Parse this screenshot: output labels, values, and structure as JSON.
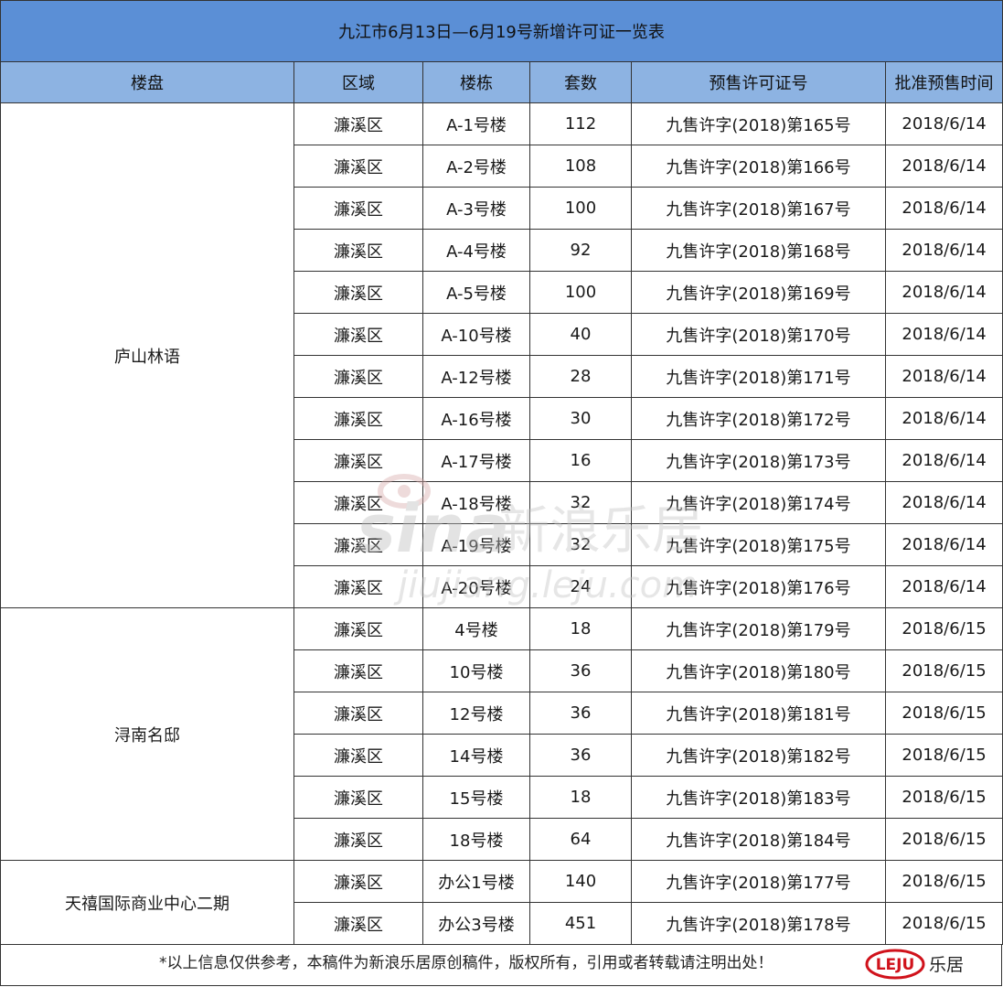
{
  "title": "九江市6月13日—6月19号新增许可证一览表",
  "headers": [
    "楼盘",
    "区域",
    "楼栋",
    "套数",
    "预售许可证号",
    "批准预售时间"
  ],
  "projects": [
    {
      "name": "庐山林语",
      "rows": [
        {
          "district": "濂溪区",
          "building": "A-1号楼",
          "units": "112",
          "permit": "九售许字(2018)第165号",
          "date": "2018/6/14"
        },
        {
          "district": "濂溪区",
          "building": "A-2号楼",
          "units": "108",
          "permit": "九售许字(2018)第166号",
          "date": "2018/6/14"
        },
        {
          "district": "濂溪区",
          "building": "A-3号楼",
          "units": "100",
          "permit": "九售许字(2018)第167号",
          "date": "2018/6/14"
        },
        {
          "district": "濂溪区",
          "building": "A-4号楼",
          "units": "92",
          "permit": "九售许字(2018)第168号",
          "date": "2018/6/14"
        },
        {
          "district": "濂溪区",
          "building": "A-5号楼",
          "units": "100",
          "permit": "九售许字(2018)第169号",
          "date": "2018/6/14"
        },
        {
          "district": "濂溪区",
          "building": "A-10号楼",
          "units": "40",
          "permit": "九售许字(2018)第170号",
          "date": "2018/6/14"
        },
        {
          "district": "濂溪区",
          "building": "A-12号楼",
          "units": "28",
          "permit": "九售许字(2018)第171号",
          "date": "2018/6/14"
        },
        {
          "district": "濂溪区",
          "building": "A-16号楼",
          "units": "30",
          "permit": "九售许字(2018)第172号",
          "date": "2018/6/14"
        },
        {
          "district": "濂溪区",
          "building": "A-17号楼",
          "units": "16",
          "permit": "九售许字(2018)第173号",
          "date": "2018/6/14"
        },
        {
          "district": "濂溪区",
          "building": "A-18号楼",
          "units": "32",
          "permit": "九售许字(2018)第174号",
          "date": "2018/6/14"
        },
        {
          "district": "濂溪区",
          "building": "A-19号楼",
          "units": "32",
          "permit": "九售许字(2018)第175号",
          "date": "2018/6/14"
        },
        {
          "district": "濂溪区",
          "building": "A-20号楼",
          "units": "24",
          "permit": "九售许字(2018)第176号",
          "date": "2018/6/14"
        }
      ]
    },
    {
      "name": "浔南名邸",
      "rows": [
        {
          "district": "濂溪区",
          "building": "4号楼",
          "units": "18",
          "permit": "九售许字(2018)第179号",
          "date": "2018/6/15"
        },
        {
          "district": "濂溪区",
          "building": "10号楼",
          "units": "36",
          "permit": "九售许字(2018)第180号",
          "date": "2018/6/15"
        },
        {
          "district": "濂溪区",
          "building": "12号楼",
          "units": "36",
          "permit": "九售许字(2018)第181号",
          "date": "2018/6/15"
        },
        {
          "district": "濂溪区",
          "building": "14号楼",
          "units": "36",
          "permit": "九售许字(2018)第182号",
          "date": "2018/6/15"
        },
        {
          "district": "濂溪区",
          "building": "15号楼",
          "units": "18",
          "permit": "九售许字(2018)第183号",
          "date": "2018/6/15"
        },
        {
          "district": "濂溪区",
          "building": "18号楼",
          "units": "64",
          "permit": "九售许字(2018)第184号",
          "date": "2018/6/15"
        }
      ]
    },
    {
      "name": "天禧国际商业中心二期",
      "rows": [
        {
          "district": "濂溪区",
          "building": "办公1号楼",
          "units": "140",
          "permit": "九售许字(2018)第177号",
          "date": "2018/6/15"
        },
        {
          "district": "濂溪区",
          "building": "办公3号楼",
          "units": "451",
          "permit": "九售许字(2018)第178号",
          "date": "2018/6/15"
        }
      ]
    }
  ],
  "footer": "*以上信息仅供参考，本稿件为新浪乐居原创稿件，版权所有，引用或者转载请注明出处！",
  "logo": {
    "mark": "LEJU",
    "text": "乐居",
    "color": "#d0121b"
  },
  "watermark": {
    "brand": "sina",
    "cn": "新浪乐居",
    "url": "jiujiang.leju.com"
  },
  "colors": {
    "title_bg": "#5b8fd6",
    "header_bg": "#8db3e2"
  }
}
